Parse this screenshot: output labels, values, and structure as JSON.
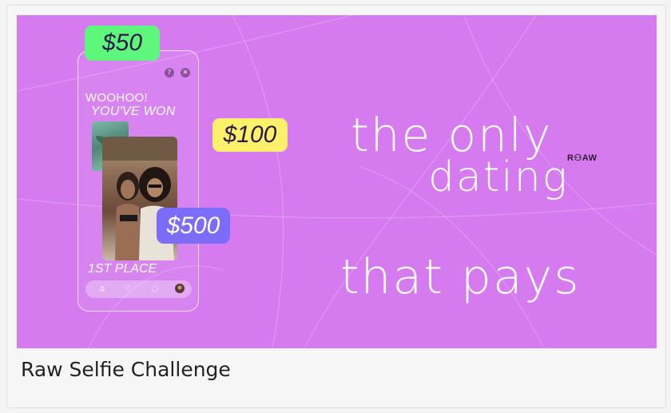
{
  "banner": {
    "background_color": "#d57bef",
    "phone": {
      "woohoo": "WOOHOO!",
      "youve_won": "YOU'VE WON",
      "first_place": "1ST PLACE",
      "help_icon": "?",
      "close_icon": "✕",
      "nav": {
        "home": "home-icon",
        "heart": "heart-icon",
        "chat": "chat-icon",
        "profile": "avatar-icon"
      }
    },
    "prices": {
      "p50": "$50",
      "p100": "$100",
      "p500": "$500"
    },
    "price_colors": {
      "p50": "#5ef77c",
      "p100": "#fdf16c",
      "p500": "#7b6cf9"
    },
    "headline": {
      "line1": "the only",
      "line2": "dating",
      "line3": "that pays"
    },
    "logo": "R⚇AW"
  },
  "caption": "Raw Selfie Challenge"
}
